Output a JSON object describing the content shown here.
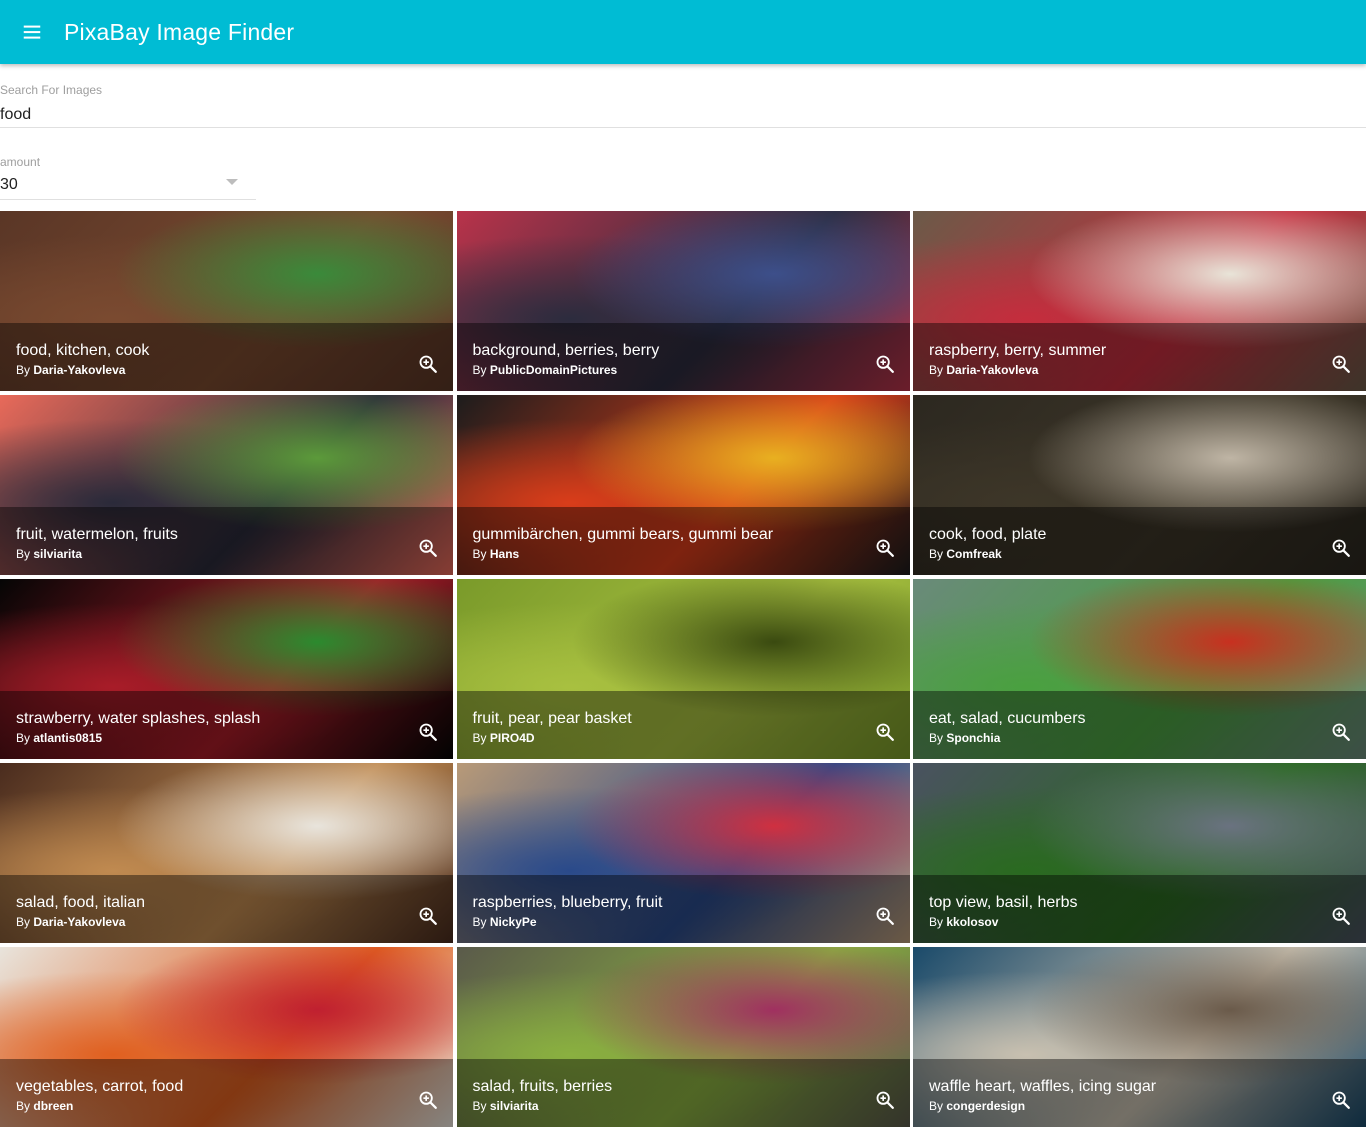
{
  "app": {
    "title": "PixaBay Image Finder",
    "menu_icon": "hamburger-menu-icon"
  },
  "search": {
    "label": "Search For Images",
    "value": "food"
  },
  "amount": {
    "label": "amount",
    "value": "30"
  },
  "tiles": [
    {
      "tags": "food, kitchen, cook",
      "by": "By",
      "user": "Daria-Yakovleva",
      "colors": [
        "#5a3626",
        "#7a4a30",
        "#3a8a3a"
      ]
    },
    {
      "tags": "background, berries, berry",
      "by": "By",
      "user": "PublicDomainPictures",
      "colors": [
        "#b8334a",
        "#2c2c3e",
        "#3d4f8a"
      ]
    },
    {
      "tags": "raspberry, berry, summer",
      "by": "By",
      "user": "Daria-Yakovleva",
      "colors": [
        "#6b5a48",
        "#c42d3d",
        "#e8e4d8"
      ]
    },
    {
      "tags": "fruit, watermelon, fruits",
      "by": "By",
      "user": "silviarita",
      "colors": [
        "#e86a5a",
        "#2a2a3a",
        "#5c9a3a"
      ]
    },
    {
      "tags": "gummibärchen, gummi bears, gummi bear",
      "by": "By",
      "user": "Hans",
      "colors": [
        "#1c1c1c",
        "#d93d1a",
        "#e8b020"
      ]
    },
    {
      "tags": "cook, food, plate",
      "by": "By",
      "user": "Comfreak",
      "colors": [
        "#2c2820",
        "#3d3628",
        "#bfb5a5"
      ]
    },
    {
      "tags": "strawberry, water splashes, splash",
      "by": "By",
      "user": "atlantis0815",
      "colors": [
        "#050505",
        "#a81c28",
        "#2b8a2e"
      ]
    },
    {
      "tags": "fruit, pear, pear basket",
      "by": "By",
      "user": "PIRO4D",
      "colors": [
        "#7a9a2a",
        "#a8c040",
        "#3a4a10"
      ]
    },
    {
      "tags": "eat, salad, cucumbers",
      "by": "By",
      "user": "Sponchia",
      "colors": [
        "#6a8a7a",
        "#4aa040",
        "#c83020"
      ]
    },
    {
      "tags": "salad, food, italian",
      "by": "By",
      "user": "Daria-Yakovleva",
      "colors": [
        "#4a2c1e",
        "#c08a50",
        "#e8e4dc"
      ]
    },
    {
      "tags": "raspberries, blueberry, fruit",
      "by": "By",
      "user": "NickyPe",
      "colors": [
        "#b89a78",
        "#2a4a8a",
        "#d03040"
      ]
    },
    {
      "tags": "top view, basil, herbs",
      "by": "By",
      "user": "kkolosov",
      "colors": [
        "#4a5260",
        "#2a6a20",
        "#6a7280"
      ]
    },
    {
      "tags": "vegetables, carrot, food",
      "by": "By",
      "user": "dbreen",
      "colors": [
        "#e8e4dc",
        "#e06020",
        "#c02030"
      ]
    },
    {
      "tags": "salad, fruits, berries",
      "by": "By",
      "user": "silviarita",
      "colors": [
        "#5a5a4a",
        "#8ab040",
        "#a03060"
      ]
    },
    {
      "tags": "waffle heart, waffles, icing sugar",
      "by": "By",
      "user": "congerdesign",
      "colors": [
        "#1a4a6a",
        "#c8c0b0",
        "#6a5a4a"
      ]
    }
  ],
  "zoom_icon": "zoom-in-icon"
}
